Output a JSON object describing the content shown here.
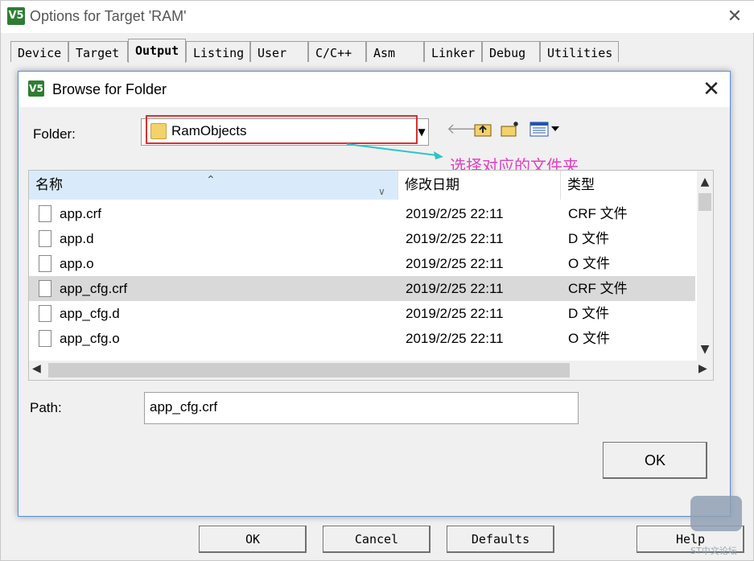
{
  "outer_window": {
    "title": "Options for Target 'RAM'",
    "logo_text": "V5",
    "close_glyph": "✕",
    "tabs": [
      {
        "label": "Device"
      },
      {
        "label": "Target"
      },
      {
        "label": "Output"
      },
      {
        "label": "Listing"
      },
      {
        "label": "User"
      },
      {
        "label": "C/C++"
      },
      {
        "label": "Asm"
      },
      {
        "label": "Linker"
      },
      {
        "label": "Debug"
      },
      {
        "label": "Utilities"
      }
    ],
    "active_tab": "Output",
    "buttons": {
      "ok": "OK",
      "cancel": "Cancel",
      "defaults": "Defaults",
      "help": "Help"
    }
  },
  "dialog": {
    "title": "Browse for Folder",
    "logo_text": "V5",
    "close_glyph": "✕",
    "folder_label": "Folder:",
    "folder_value": "RamObjects",
    "folder_icon": "folder-icon",
    "toolbar": {
      "back_icon": "back-arrow-icon",
      "up_icon": "up-folder-icon",
      "new_folder_icon": "new-folder-icon",
      "view_menu_icon": "view-menu-icon"
    },
    "annotation": "选择对应的文件夹",
    "annotation_color": "#e040c0",
    "highlight_color": "#d93030",
    "columns": {
      "name": "名称",
      "date": "修改日期",
      "type": "类型"
    },
    "files": [
      {
        "name": "app.crf",
        "date": "2019/2/25 22:11",
        "type": "CRF 文件"
      },
      {
        "name": "app.d",
        "date": "2019/2/25 22:11",
        "type": "D 文件"
      },
      {
        "name": "app.o",
        "date": "2019/2/25 22:11",
        "type": "O 文件"
      },
      {
        "name": "app_cfg.crf",
        "date": "2019/2/25 22:11",
        "type": "CRF 文件"
      },
      {
        "name": "app_cfg.d",
        "date": "2019/2/25 22:11",
        "type": "D 文件"
      },
      {
        "name": "app_cfg.o",
        "date": "2019/2/25 22:11",
        "type": "O 文件"
      }
    ],
    "selected_file": "app_cfg.crf",
    "path_label": "Path:",
    "path_value": "app_cfg.crf",
    "ok_label": "OK"
  },
  "watermark": {
    "text": "ST中文论坛"
  }
}
